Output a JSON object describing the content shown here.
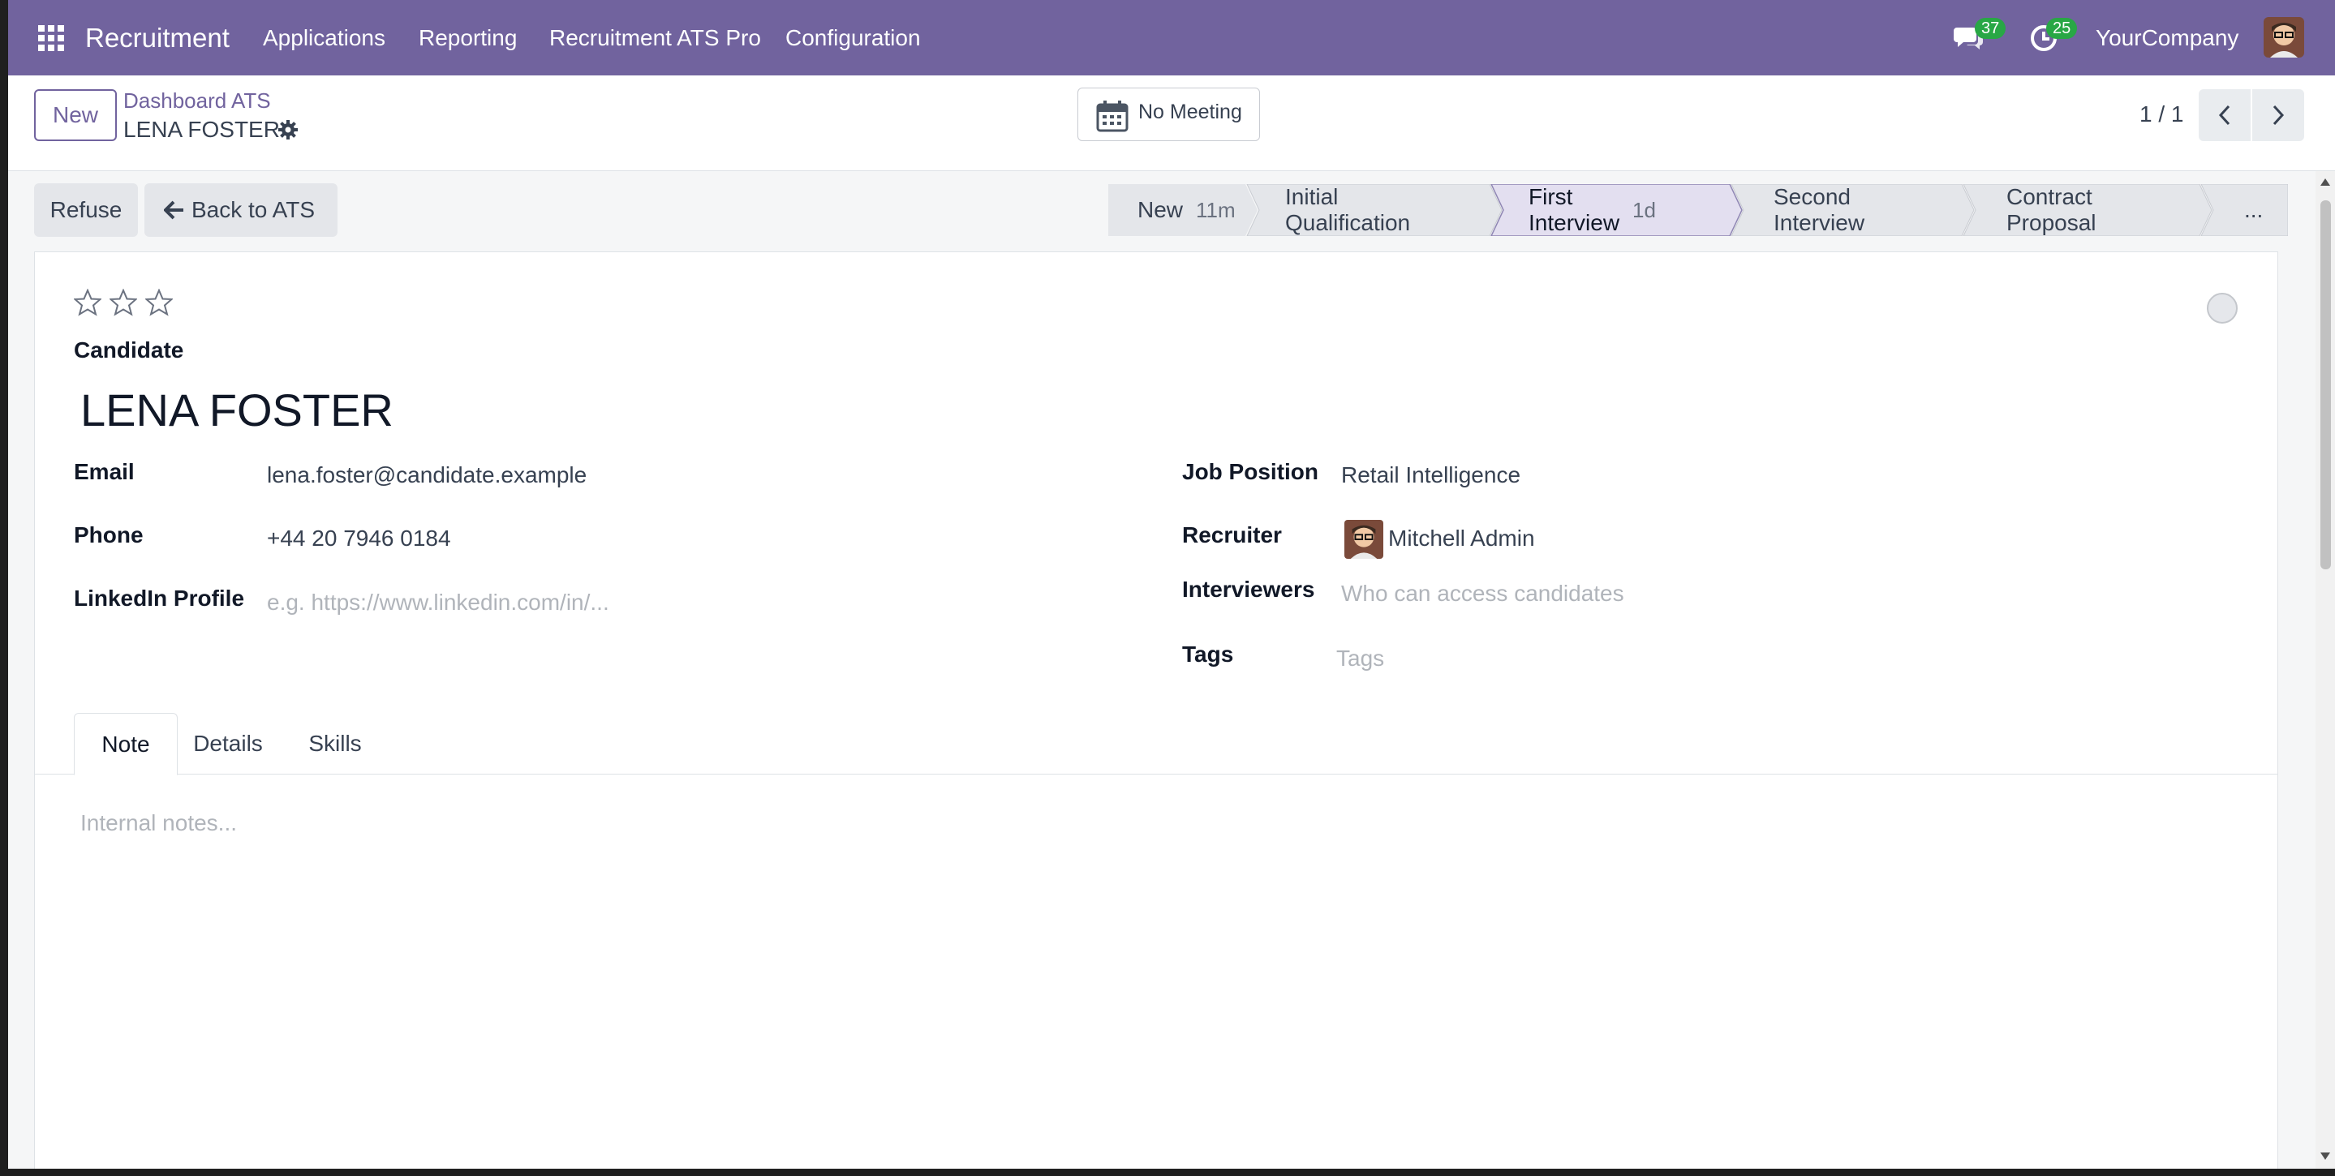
{
  "navbar": {
    "app_name": "Recruitment",
    "menu": [
      "Applications",
      "Reporting",
      "Recruitment ATS Pro",
      "Configuration"
    ],
    "messages_count": "37",
    "activities_count": "25",
    "company": "YourCompany"
  },
  "control": {
    "new_label": "New",
    "breadcrumb_parent": "Dashboard ATS",
    "breadcrumb_current": "LENA FOSTER",
    "meeting_label": "No Meeting",
    "pager": "1 / 1"
  },
  "actions": {
    "refuse_label": "Refuse",
    "back_label": "Back to ATS"
  },
  "stages": [
    {
      "label": "New",
      "duration": "11m"
    },
    {
      "label": "Initial Qualification",
      "duration": ""
    },
    {
      "label": "First Interview",
      "duration": "1d",
      "active": true
    },
    {
      "label": "Second Interview",
      "duration": ""
    },
    {
      "label": "Contract Proposal",
      "duration": ""
    },
    {
      "label": "...",
      "duration": ""
    }
  ],
  "form": {
    "candidate_label": "Candidate",
    "candidate_name": "LENA FOSTER",
    "priority_stars": 0,
    "email_label": "Email",
    "email_value": "lena.foster@candidate.example",
    "phone_label": "Phone",
    "phone_value": "+44 20 7946 0184",
    "linkedin_label": "LinkedIn Profile",
    "linkedin_placeholder": "e.g. https://www.linkedin.com/in/...",
    "job_label": "Job Position",
    "job_value": "Retail Intelligence",
    "recruiter_label": "Recruiter",
    "recruiter_value": "Mitchell Admin",
    "interviewers_label": "Interviewers",
    "interviewers_placeholder": "Who can access candidates",
    "tags_label": "Tags",
    "tags_placeholder": "Tags"
  },
  "tabs": [
    "Note",
    "Details",
    "Skills"
  ],
  "notes_placeholder": "Internal notes...",
  "colors": {
    "brand": "#71639e",
    "badge": "#28a745"
  }
}
